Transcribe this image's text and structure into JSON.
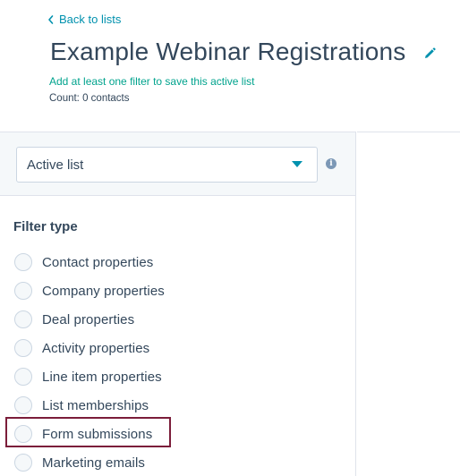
{
  "header": {
    "back_label": "Back to lists",
    "title": "Example Webinar Registrations",
    "hint": "Add at least one filter to save this active list",
    "count": "Count: 0 contacts"
  },
  "list_type": {
    "selected": "Active list"
  },
  "filters": {
    "heading": "Filter type",
    "options": [
      {
        "label": "Contact properties"
      },
      {
        "label": "Company properties"
      },
      {
        "label": "Deal properties"
      },
      {
        "label": "Activity properties"
      },
      {
        "label": "Line item properties"
      },
      {
        "label": "List memberships"
      },
      {
        "label": "Form submissions"
      },
      {
        "label": "Marketing emails"
      }
    ],
    "highlighted": "Form submissions"
  },
  "colors": {
    "link": "#0091ae",
    "hint": "#00a38d",
    "text": "#33475b",
    "highlight_border": "#7b1d3a"
  },
  "icons": [
    "chevron-left-icon",
    "pencil-icon",
    "caret-down-icon",
    "info-icon"
  ]
}
